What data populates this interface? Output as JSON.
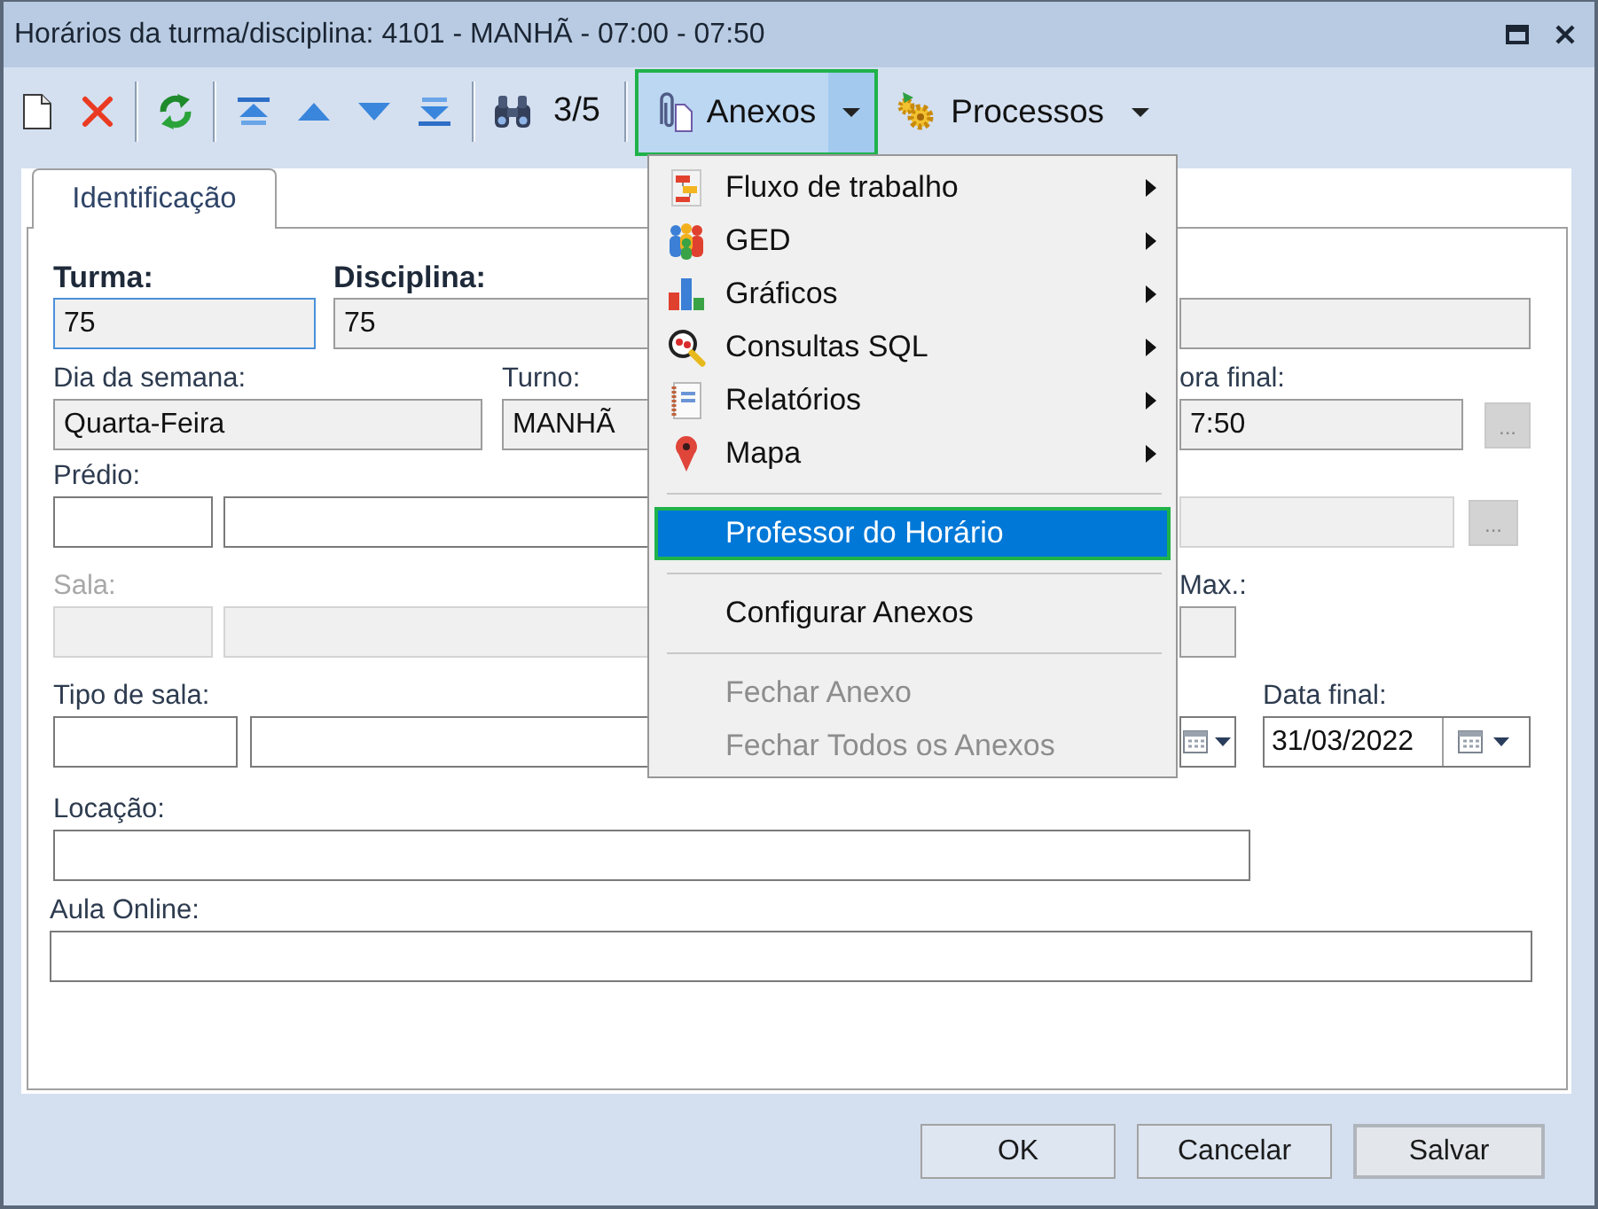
{
  "window": {
    "title": "Horários da turma/disciplina: 4101 - MANHÃ - 07:00 - 07:50"
  },
  "toolbar": {
    "record_counter": "3/5",
    "menus": [
      {
        "label": "Anexos",
        "expanded": true,
        "highlighted": true
      },
      {
        "label": "Processos",
        "expanded": false,
        "highlighted": false
      }
    ]
  },
  "tabs": [
    {
      "label": "Identificação",
      "selected": true
    }
  ],
  "form": {
    "rows": [
      {
        "fields": [
          {
            "kind": "text",
            "label": "Turma:",
            "value": "75",
            "required": true,
            "readonly": true,
            "disabled": false,
            "focused": true
          },
          {
            "kind": "text",
            "label": "Disciplina:",
            "value": "75",
            "required": true,
            "readonly": true,
            "disabled": false,
            "focused": false
          },
          {
            "kind": "text",
            "readonly": true,
            "disabled": false,
            "focused": false
          }
        ]
      },
      {
        "fields": [
          {
            "kind": "text",
            "label": "Dia da semana:",
            "value": "Quarta-Feira",
            "required": false,
            "readonly": true,
            "disabled": false,
            "focused": false
          },
          {
            "kind": "text",
            "label": "Turno:",
            "value": "MANHÃ",
            "required": false,
            "readonly": true,
            "disabled": false,
            "focused": false
          },
          {
            "kind": "lookup",
            "label": "ora final:",
            "value": "7:50",
            "button": "...",
            "required": false,
            "readonly": true,
            "disabled": false,
            "focused": false
          }
        ]
      },
      {
        "fields": [
          {
            "kind": "text",
            "label": "Prédio:",
            "required": false,
            "readonly": false,
            "disabled": false,
            "focused": false
          },
          {
            "kind": "text",
            "readonly": false,
            "disabled": false,
            "focused": false
          },
          {
            "kind": "lookup",
            "button": "...",
            "readonly": true,
            "disabled": true,
            "focused": false
          }
        ]
      },
      {
        "fields": [
          {
            "kind": "text",
            "label": "Sala:",
            "required": false,
            "readonly": true,
            "disabled": true,
            "focused": false
          },
          {
            "kind": "text",
            "readonly": true,
            "disabled": true,
            "focused": false
          },
          {
            "kind": "text",
            "label": "Max.:",
            "required": false,
            "readonly": true,
            "disabled": false,
            "focused": false
          }
        ]
      },
      {
        "fields": [
          {
            "kind": "text",
            "label": "Tipo de sala:",
            "required": false,
            "readonly": false,
            "disabled": false,
            "focused": false
          },
          {
            "kind": "text",
            "readonly": false,
            "disabled": false,
            "focused": false
          },
          {
            "kind": "date",
            "readonly": false,
            "disabled": false,
            "focused": false
          },
          {
            "kind": "date",
            "label": "Data final:",
            "value": "31/03/2022",
            "required": false,
            "readonly": false,
            "disabled": false,
            "focused": false
          }
        ]
      },
      {
        "fields": [
          {
            "kind": "text",
            "label": "Locação:",
            "required": false,
            "readonly": false,
            "disabled": false,
            "focused": false
          }
        ]
      },
      {
        "fields": [
          {
            "kind": "text",
            "label": "Aula Online:",
            "required": false,
            "readonly": false,
            "disabled": false,
            "focused": false
          }
        ]
      }
    ]
  },
  "menu": {
    "items": [
      {
        "kind": "submenu",
        "label": "Fluxo de trabalho",
        "disabled": false,
        "selected": false,
        "highlighted": false
      },
      {
        "kind": "submenu",
        "label": "GED",
        "disabled": false,
        "selected": false,
        "highlighted": false
      },
      {
        "kind": "submenu",
        "label": "Gráficos",
        "disabled": false,
        "selected": false,
        "highlighted": false
      },
      {
        "kind": "submenu",
        "label": "Consultas SQL",
        "disabled": false,
        "selected": false,
        "highlighted": false
      },
      {
        "kind": "submenu",
        "label": "Relatórios",
        "disabled": false,
        "selected": false,
        "highlighted": false
      },
      {
        "kind": "submenu",
        "label": "Mapa",
        "disabled": false,
        "selected": false,
        "highlighted": false
      },
      {
        "kind": "separator"
      },
      {
        "kind": "item",
        "label": "Professor do Horário",
        "disabled": false,
        "selected": true,
        "highlighted": true
      },
      {
        "kind": "separator"
      },
      {
        "kind": "item",
        "label": "Configurar Anexos",
        "disabled": false,
        "selected": false,
        "highlighted": false
      },
      {
        "kind": "separator"
      },
      {
        "kind": "item",
        "label": "Fechar Anexo",
        "disabled": true,
        "selected": false,
        "highlighted": false
      },
      {
        "kind": "item",
        "label": "Fechar Todos os Anexos",
        "disabled": true,
        "selected": false,
        "highlighted": false
      }
    ]
  },
  "buttons": [
    {
      "label": "OK",
      "default": false
    },
    {
      "label": "Cancelar",
      "default": false
    },
    {
      "label": "Salvar",
      "default": true
    }
  ]
}
